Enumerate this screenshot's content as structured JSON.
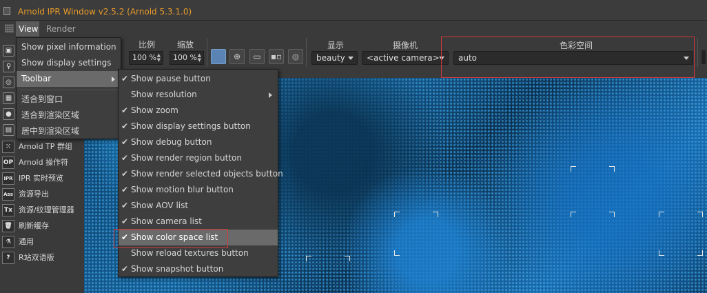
{
  "window": {
    "title": "Arnold IPR Window v2.5.2 (Arnold 5.3.1.0)",
    "title_color": "#e69a2b"
  },
  "menubar": {
    "view": "View",
    "render": "Render"
  },
  "view_menu": {
    "items": [
      {
        "label": "Show pixel information"
      },
      {
        "label": "Show display settings"
      },
      {
        "label": "Toolbar",
        "submenu": true,
        "active": true
      },
      {
        "label": "适合到窗口"
      },
      {
        "label": "适合到渲染区域"
      },
      {
        "label": "居中到渲染区域"
      }
    ]
  },
  "toolbar_menu": {
    "items": [
      {
        "label": "Show pause button",
        "checked": true
      },
      {
        "label": "Show resolution",
        "checked": false,
        "submenu": true
      },
      {
        "label": "Show zoom",
        "checked": true
      },
      {
        "label": "Show display settings button",
        "checked": true
      },
      {
        "label": "Show debug button",
        "checked": true
      },
      {
        "label": "Show render region button",
        "checked": true
      },
      {
        "label": "Show render selected objects button",
        "checked": true
      },
      {
        "label": "Show motion blur button",
        "checked": true
      },
      {
        "label": "Show AOV list",
        "checked": true
      },
      {
        "label": "Show camera list",
        "checked": true
      },
      {
        "label": "Show color space list",
        "checked": true,
        "active": true
      },
      {
        "label": "Show reload textures button",
        "checked": false
      },
      {
        "label": "Show snapshot button",
        "checked": true
      }
    ]
  },
  "toolbar": {
    "ratio_label": "比例",
    "ratio_value": "100 %",
    "zoom_label": "缩放",
    "zoom_value": "100 %",
    "display_label": "显示",
    "display_value": "beauty",
    "camera_label": "摄像机",
    "camera_value": "<active camera>",
    "colorspace_label": "色彩空间",
    "colorspace_value": "auto"
  },
  "left_panel": {
    "items": [
      {
        "icon": "⁙",
        "label": "Arnold TP 群组"
      },
      {
        "icon": "OP",
        "label": "Arnold 操作符"
      },
      {
        "icon": "IPR",
        "label": "IPR 实时预览"
      },
      {
        "icon": "Ass",
        "label": "资源导出"
      },
      {
        "icon": "Tx",
        "label": "资源/纹理管理器"
      },
      {
        "icon": "🗑",
        "label": "刷新缓存"
      },
      {
        "icon": "⚗",
        "label": "通用"
      },
      {
        "icon": "?",
        "label": "R站双语版"
      }
    ]
  },
  "colors": {
    "highlight": "#d23a3a",
    "active_button": "#5a84b4"
  }
}
